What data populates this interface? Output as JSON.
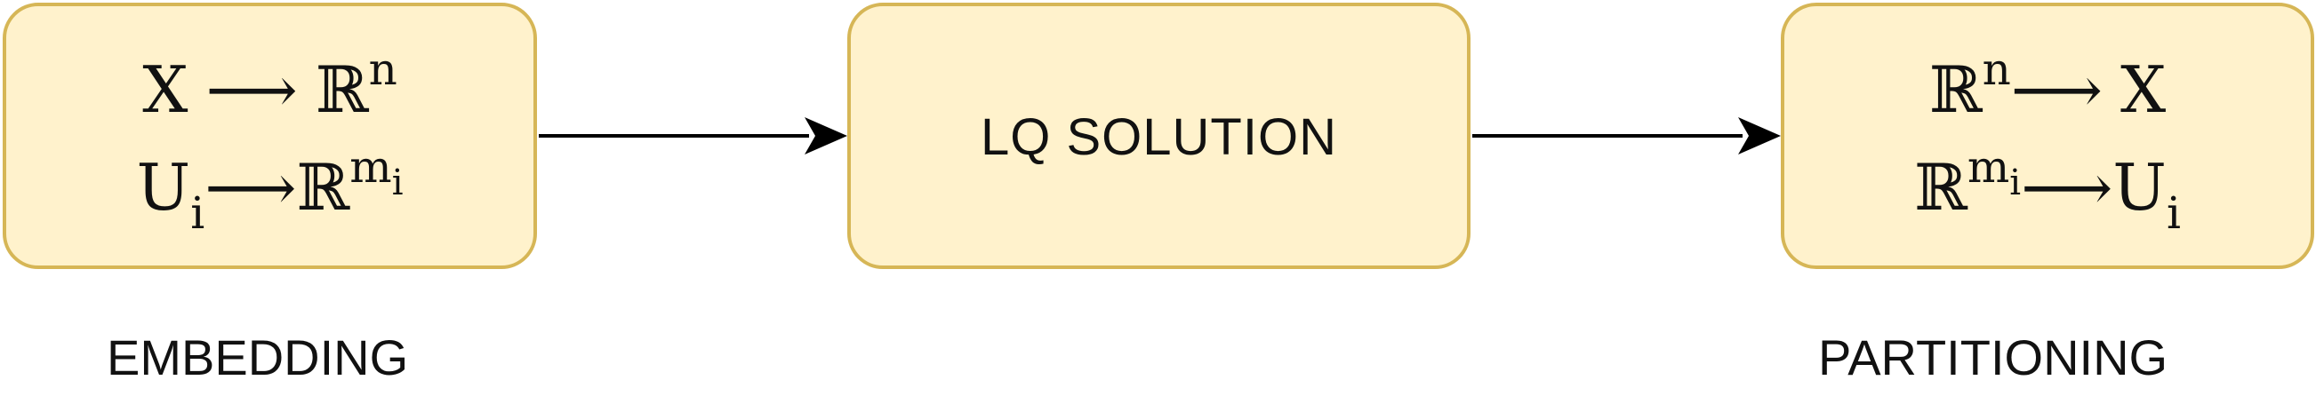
{
  "colors": {
    "box_fill": "#fff2cc",
    "box_border": "#d6b656",
    "text": "#111111",
    "arrow": "#000000"
  },
  "embedding": {
    "line1": {
      "left": "X",
      "arrow": "⟶",
      "right": "ℝ",
      "right_sup": "n"
    },
    "line2": {
      "left": "U",
      "left_sub": "i",
      "arrow": "⟶",
      "right": "ℝ",
      "right_sup": "m",
      "right_sup_sub": "i"
    },
    "caption": "EMBEDDING"
  },
  "lq": {
    "label": "LQ SOLUTION"
  },
  "partitioning": {
    "line1": {
      "left": "ℝ",
      "left_sup": "n",
      "arrow": "⟶",
      "right": "X"
    },
    "line2": {
      "left": "ℝ",
      "left_sup": "m",
      "left_sup_sub": "i",
      "arrow": "⟶",
      "right": "U",
      "right_sub": "i"
    },
    "caption": "PARTITIONING"
  }
}
